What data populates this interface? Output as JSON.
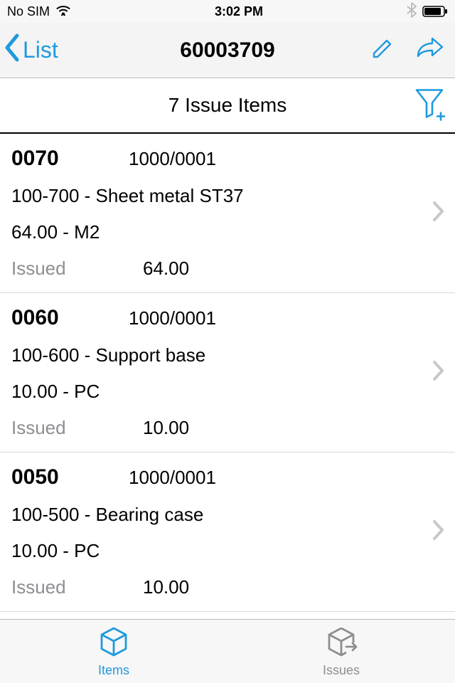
{
  "status": {
    "carrier": "No SIM",
    "time": "3:02 PM"
  },
  "nav": {
    "back_label": "List",
    "title": "60003709"
  },
  "subheader": {
    "title": "7 Issue Items"
  },
  "items": [
    {
      "id": "0070",
      "ref": "1000/0001",
      "desc": "100-700 - Sheet metal ST37",
      "qty": "64.00 - M2",
      "issued_label": "Issued",
      "issued_val": "64.00"
    },
    {
      "id": "0060",
      "ref": "1000/0001",
      "desc": "100-600 - Support base",
      "qty": "10.00 - PC",
      "issued_label": "Issued",
      "issued_val": "10.00"
    },
    {
      "id": "0050",
      "ref": "1000/0001",
      "desc": "100-500 - Bearing case",
      "qty": "10.00 - PC",
      "issued_label": "Issued",
      "issued_val": "10.00"
    }
  ],
  "tabs": {
    "items_label": "Items",
    "issues_label": "Issues"
  }
}
